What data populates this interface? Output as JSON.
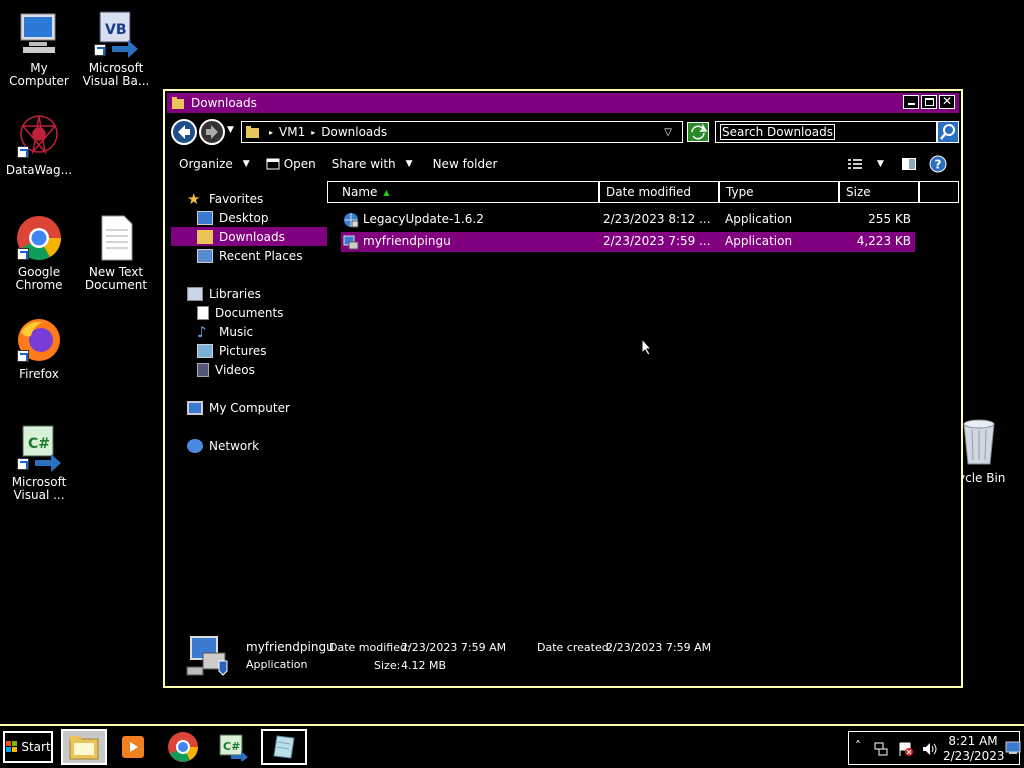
{
  "desktop": {
    "icons": [
      {
        "label": "My Computer"
      },
      {
        "label": "Microsoft Visual Ba..."
      },
      {
        "label": "DataWag..."
      },
      {
        "label": "Google Chrome"
      },
      {
        "label": "New Text Document"
      },
      {
        "label": "Firefox"
      },
      {
        "label": "Microsoft Visual ..."
      },
      {
        "label": "ycle Bin"
      }
    ]
  },
  "window": {
    "title": "Downloads",
    "address": {
      "root": "VM1",
      "current": "Downloads"
    },
    "search_placeholder": "Search Downloads",
    "commands": {
      "organize": "Organize",
      "open": "Open",
      "share": "Share with",
      "new_folder": "New folder"
    },
    "nav": {
      "favorites": "Favorites",
      "desktop": "Desktop",
      "downloads": "Downloads",
      "recent": "Recent Places",
      "libraries": "Libraries",
      "documents": "Documents",
      "music": "Music",
      "pictures": "Pictures",
      "videos": "Videos",
      "computer": "My Computer",
      "network": "Network"
    },
    "columns": {
      "name": "Name",
      "date": "Date modified",
      "type": "Type",
      "size": "Size"
    },
    "files": [
      {
        "name": "LegacyUpdate-1.6.2",
        "date": "2/23/2023 8:12 ...",
        "type": "Application",
        "size": "255 KB"
      },
      {
        "name": "myfriendpingu",
        "date": "2/23/2023 7:59 ...",
        "type": "Application",
        "size": "4,223 KB"
      }
    ],
    "details": {
      "name": "myfriendpingu",
      "type": "Application",
      "modified_label": "Date modified:",
      "modified": "2/23/2023 7:59 AM",
      "created_label": "Date created:",
      "created": "2/23/2023 7:59 AM",
      "size_label": "Size:",
      "size": "4.12 MB"
    }
  },
  "taskbar": {
    "start": "Start",
    "time": "8:21 AM",
    "date": "2/23/2023"
  },
  "colors": {
    "selection": "#800080",
    "border": "#ffffb0"
  }
}
